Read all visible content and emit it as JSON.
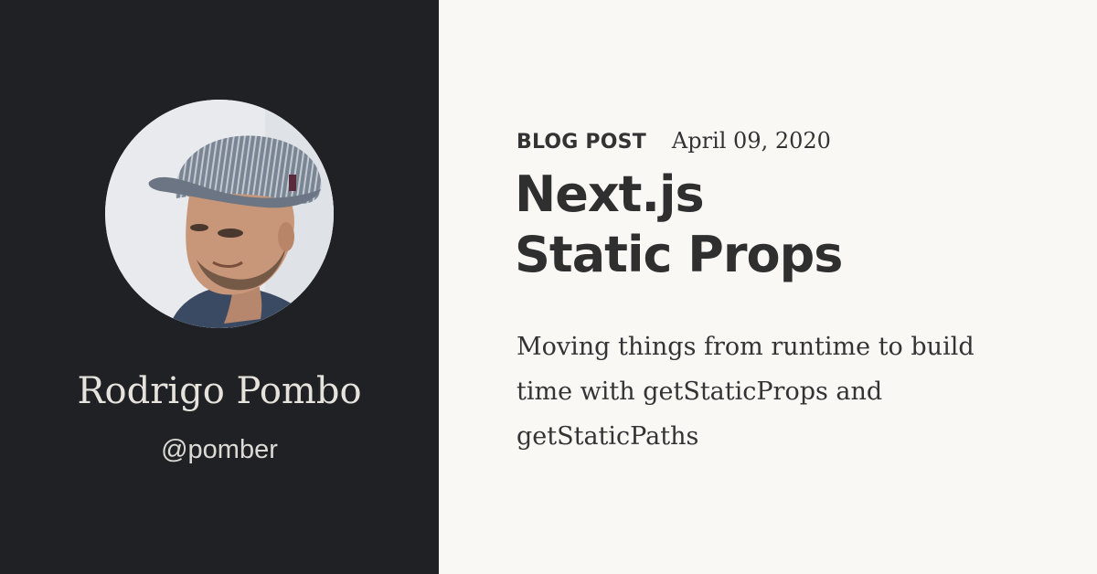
{
  "author": {
    "name": "Rodrigo Pombo",
    "handle": "@pomber"
  },
  "post": {
    "kind": "BLOG POST",
    "date": "April 09, 2020",
    "title_lines": [
      "Next.js",
      "Static Props"
    ],
    "description": "Moving things from runtime to build time with getStaticProps and getStaticPaths"
  },
  "colors": {
    "left_panel": "#202125",
    "page_background": "#f9f8f5",
    "heading_text": "#2f2f2f",
    "light_text": "#e6e3dd"
  }
}
